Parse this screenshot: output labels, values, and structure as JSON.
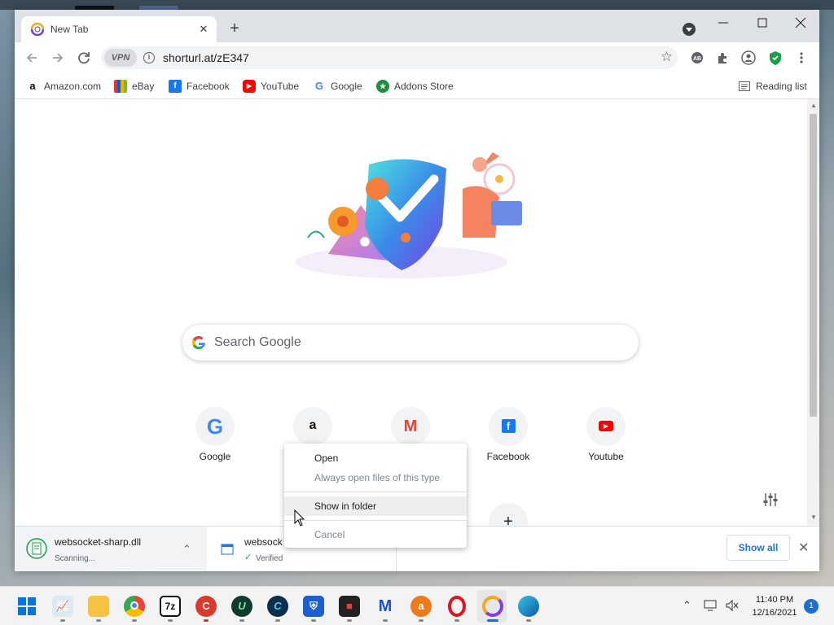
{
  "browser": {
    "tab": {
      "title": "New Tab",
      "close_icon": "close-icon"
    },
    "address": {
      "url": "shorturl.at/zE347",
      "vpn_label": "VPN"
    },
    "bookmarks": [
      {
        "label": "Amazon.com",
        "icon": "amazon-icon"
      },
      {
        "label": "eBay",
        "icon": "ebay-icon"
      },
      {
        "label": "Facebook",
        "icon": "facebook-icon"
      },
      {
        "label": "YouTube",
        "icon": "youtube-icon"
      },
      {
        "label": "Google",
        "icon": "google-icon"
      },
      {
        "label": "Addons Store",
        "icon": "addons-store-icon"
      }
    ],
    "reading_list": "Reading list"
  },
  "newtab": {
    "search_placeholder": "Search Google",
    "shortcuts": [
      {
        "label": "Google",
        "icon": "google-icon"
      },
      {
        "label": "",
        "icon": "amazon-icon"
      },
      {
        "label": "",
        "icon": "gmail-icon"
      },
      {
        "label": "Facebook",
        "icon": "facebook-icon"
      },
      {
        "label": "Youtube",
        "icon": "youtube-icon"
      }
    ]
  },
  "downloads": {
    "items": [
      {
        "name": "websocket-sharp.dll",
        "status": "Scanning..."
      },
      {
        "name": "websock",
        "status": "Verified"
      }
    ],
    "show_all": "Show all"
  },
  "context_menu": {
    "items": [
      {
        "label": "Open",
        "disabled": false
      },
      {
        "label": "Always open files of this type",
        "disabled": true
      },
      {
        "label": "Show in folder",
        "disabled": false,
        "hovered": true
      },
      {
        "label": "Cancel",
        "disabled": true
      }
    ]
  },
  "taskbar": {
    "time": "11:40 PM",
    "date": "12/16/2021",
    "notifications": "1",
    "apps": [
      "start-icon",
      "task-manager-icon",
      "file-explorer-icon",
      "chrome-icon",
      "7zip-icon",
      "ccleaner-icon",
      "u-app-icon",
      "c-app-icon",
      "shield-app-icon",
      "video-app-icon",
      "malwarebytes-icon",
      "avast-icon",
      "opera-icon",
      "browser-icon",
      "edge-like-icon"
    ]
  }
}
